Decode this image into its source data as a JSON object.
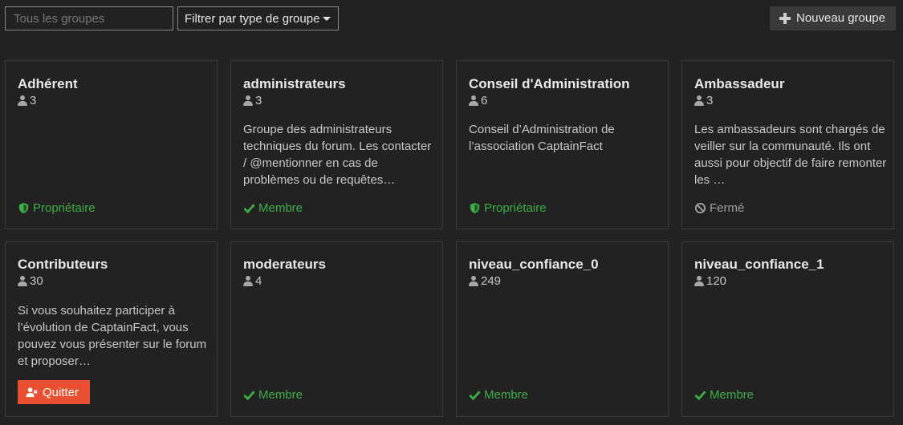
{
  "toolbar": {
    "search_placeholder": "Tous les groupes",
    "filter_label": "Filtrer par type de groupe",
    "new_group_label": "Nouveau groupe"
  },
  "colors": {
    "background": "#222222",
    "member_green": "#3fae49",
    "quit_button": "#e94f31",
    "closed_gray": "#a0a0a0"
  },
  "groups": [
    {
      "title": "Adhérent",
      "count": "3",
      "description": "",
      "status": "Propriétaire",
      "status_icon": "shield-icon"
    },
    {
      "title": "administrateurs",
      "count": "3",
      "description": "Groupe des administrateurs techniques du forum. Les contacter / @mentionner en cas de problèmes ou de requêtes…",
      "status": "Membre",
      "status_icon": "check-icon"
    },
    {
      "title": "Conseil d'Administration",
      "count": "6",
      "description": "Conseil d’Administration de l’association CaptainFact",
      "status": "Propriétaire",
      "status_icon": "shield-icon"
    },
    {
      "title": "Ambassadeur",
      "count": "3",
      "description": "Les ambassadeurs sont chargés de veiller sur la communauté. Ils ont aussi pour objectif de faire remonter les …",
      "status": "Fermé",
      "status_icon": "ban-icon"
    },
    {
      "title": "Contributeurs",
      "count": "30",
      "description": "Si vous souhaitez participer à l’évolution de CaptainFact, vous pouvez vous présenter sur le forum et proposer…",
      "status": "Quitter",
      "status_icon": "user-times-icon"
    },
    {
      "title": "moderateurs",
      "count": "4",
      "description": "",
      "status": "Membre",
      "status_icon": "check-icon"
    },
    {
      "title": "niveau_confiance_0",
      "count": "249",
      "description": "",
      "status": "Membre",
      "status_icon": "check-icon"
    },
    {
      "title": "niveau_confiance_1",
      "count": "120",
      "description": "",
      "status": "Membre",
      "status_icon": "check-icon"
    }
  ]
}
